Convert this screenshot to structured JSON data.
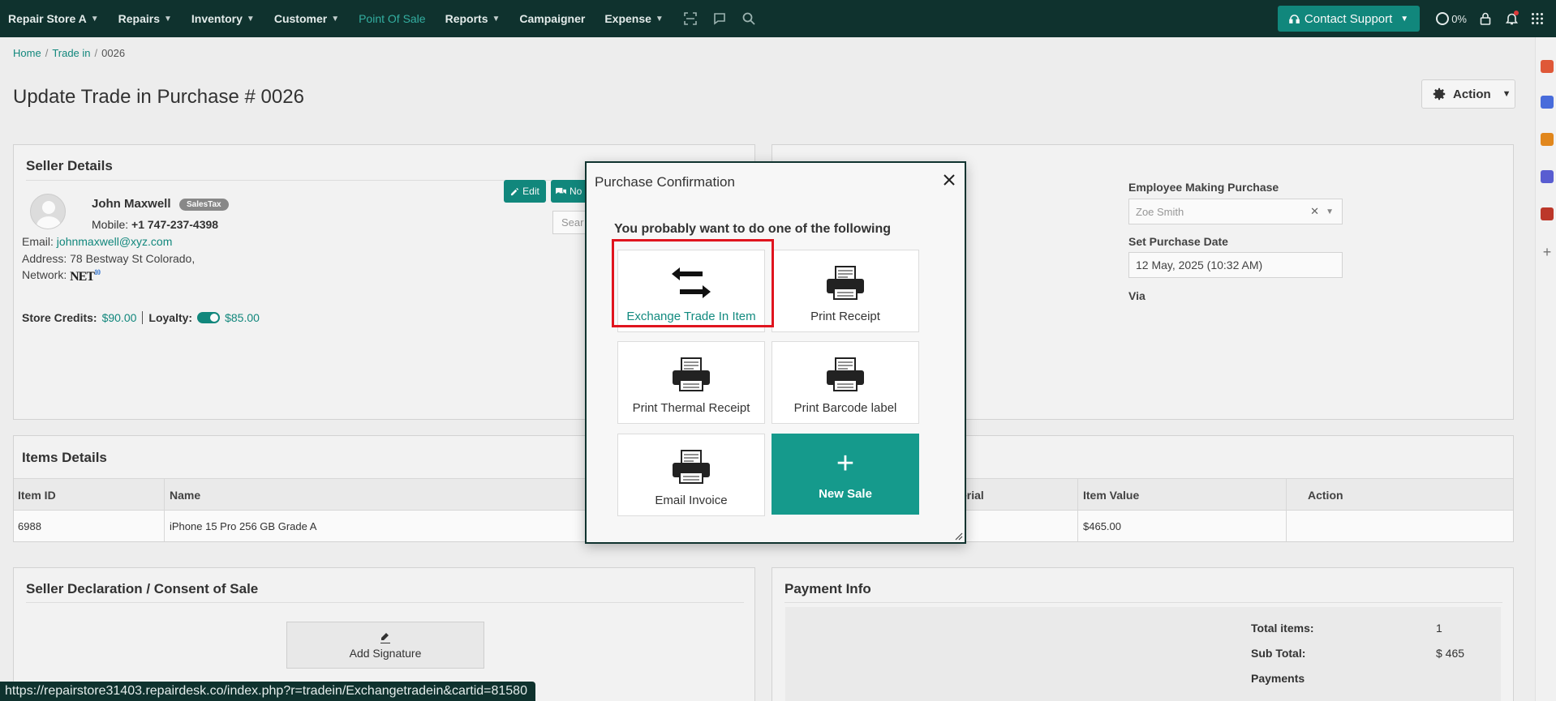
{
  "nav": {
    "store": "Repair Store A",
    "repairs": "Repairs",
    "inventory": "Inventory",
    "customer": "Customer",
    "pos": "Point Of Sale",
    "reports": "Reports",
    "campaigner": "Campaigner",
    "expense": "Expense",
    "contact_support": "Contact Support",
    "progress": "0%"
  },
  "breadcrumb": {
    "home": "Home",
    "tradein": "Trade in",
    "current": "0026"
  },
  "page_title": "Update Trade in Purchase # 0026",
  "action_label": "Action",
  "seller": {
    "title": "Seller Details",
    "name": "John Maxwell",
    "badge": "SalesTax",
    "mobile_label": "Mobile:",
    "mobile": "+1 747-237-4398",
    "email_label": "Email:",
    "email": "johnmaxwell@xyz.com",
    "address_label": "Address:",
    "address": "78 Bestway St Colorado,",
    "network_label": "Network:",
    "network_logo": "NET",
    "network_logo_sup": "10",
    "store_credits_label": "Store Credits:",
    "store_credits": "$90.00",
    "loyalty_label": "Loyalty:",
    "loyalty": "$85.00",
    "edit_label": "Edit",
    "notes_label": "No",
    "search_placeholder": "Sear"
  },
  "purchase": {
    "employee_label": "Employee Making Purchase",
    "employee_value": "Zoe Smith",
    "date_label": "Set Purchase Date",
    "date_value": "12 May, 2025 (10:32 AM)",
    "via_label": "Via"
  },
  "items": {
    "title": "Items Details",
    "headers": [
      "Item ID",
      "Name",
      "erial",
      "Item Value",
      "Action"
    ],
    "rows": [
      {
        "id": "6988",
        "name": "iPhone 15 Pro 256 GB Grade A",
        "value": "$465.00"
      }
    ]
  },
  "declaration": {
    "title": "Seller Declaration / Consent of Sale",
    "signature_label": "Add Signature"
  },
  "payment": {
    "title": "Payment Info",
    "total_items_label": "Total items:",
    "total_items": "1",
    "subtotal_label": "Sub Total:",
    "subtotal": "$ 465",
    "payments_label": "Payments"
  },
  "status_url": "https://repairstore31403.repairdesk.co/index.php?r=tradein/Exchangetradein&cartid=81580",
  "modal": {
    "title": "Purchase Confirmation",
    "subtitle": "You probably want to do one of the following",
    "options": {
      "exchange": "Exchange Trade In Item",
      "print_receipt": "Print Receipt",
      "thermal": "Print Thermal Receipt",
      "barcode": "Print Barcode label",
      "email": "Email Invoice",
      "new_sale": "New Sale"
    }
  },
  "colors": {
    "nav_bg": "#10332f",
    "accent": "#128a7f",
    "primary_tile": "#159a8c",
    "highlight": "#e0141e"
  },
  "icons": [
    "chevron-down-icon",
    "scan-icon",
    "chat-icon",
    "search-icon",
    "headset-icon",
    "lock-icon",
    "bell-icon",
    "apps-grid-icon",
    "gear-icon",
    "exchange-arrows-icon",
    "printer-icon",
    "close-icon",
    "plus-icon",
    "signature-pen-icon"
  ]
}
